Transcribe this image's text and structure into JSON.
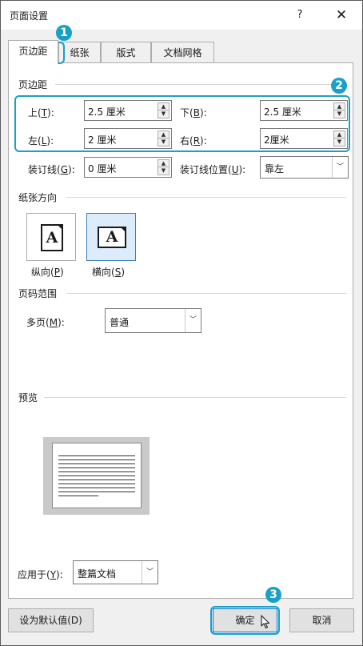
{
  "window": {
    "title": "页面设置",
    "help_label": "?",
    "close_label": "✕"
  },
  "tabs": [
    {
      "label": "页边距",
      "active": true
    },
    {
      "label": "纸张",
      "active": false
    },
    {
      "label": "版式",
      "active": false
    },
    {
      "label": "文档网格",
      "active": false
    }
  ],
  "margins": {
    "section_title": "页边距",
    "top": {
      "label": "上",
      "key": "T",
      "value": "2.5 厘米"
    },
    "bottom": {
      "label": "下",
      "key": "B",
      "value": "2.5 厘米"
    },
    "left": {
      "label": "左",
      "key": "L",
      "value": "2 厘米"
    },
    "right": {
      "label": "右",
      "key": "R",
      "value": "2厘米"
    },
    "gutter": {
      "label": "装订线",
      "key": "G",
      "value": "0 厘米"
    },
    "gutter_position": {
      "label": "装订线位置",
      "key": "U",
      "value": "靠左"
    }
  },
  "orientation": {
    "section_title": "纸张方向",
    "portrait": {
      "label": "纵向",
      "key": "P",
      "glyph": "A",
      "icon": "portrait-page-icon"
    },
    "landscape": {
      "label": "横向",
      "key": "S",
      "glyph": "A",
      "icon": "landscape-page-icon",
      "selected": true
    }
  },
  "pages": {
    "section_title": "页码范围",
    "multiple_label": "多页",
    "multiple_key": "M",
    "multiple_value": "普通"
  },
  "preview": {
    "section_title": "预览"
  },
  "apply": {
    "label": "应用于",
    "key": "Y",
    "value": "整篇文档"
  },
  "buttons": {
    "set_default": "设为默认值(D)",
    "ok": "确定",
    "cancel": "取消"
  },
  "annotations": [
    "1",
    "2",
    "3"
  ],
  "colors": {
    "annotation": "#1aa0c8",
    "selected_bg": "#dcecfc",
    "default_button_border": "#0078d7"
  }
}
